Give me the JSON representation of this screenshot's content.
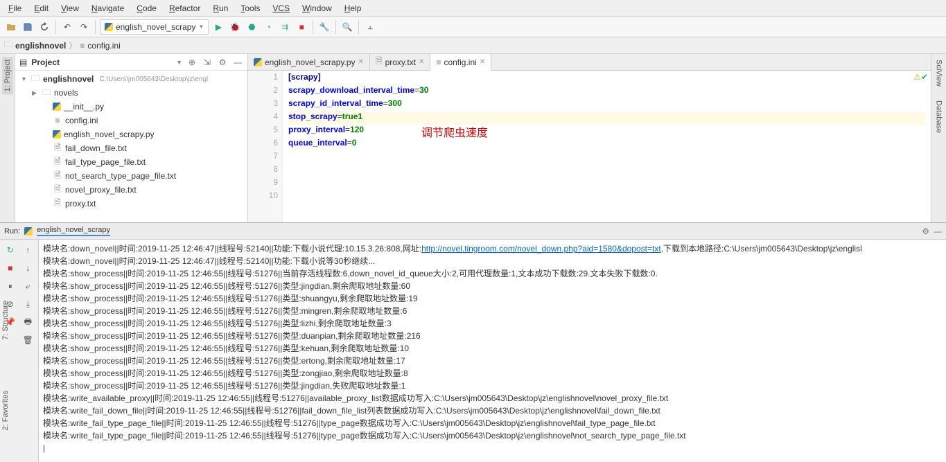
{
  "menu": {
    "file": "File",
    "edit": "Edit",
    "view": "View",
    "navigate": "Navigate",
    "code": "Code",
    "refactor": "Refactor",
    "run": "Run",
    "tools": "Tools",
    "vcs": "VCS",
    "window": "Window",
    "help": "Help"
  },
  "toolbar": {
    "run_config": "english_novel_scrapy"
  },
  "breadcrumb": {
    "root": "englishnovel",
    "file": "config.ini"
  },
  "project": {
    "title": "Project",
    "root": {
      "name": "englishnovel",
      "path": "C:\\Users\\jm005643\\Desktop\\jz\\engl"
    },
    "items": [
      {
        "name": "novels",
        "type": "folder"
      },
      {
        "name": "__init__.py",
        "type": "py"
      },
      {
        "name": "config.ini",
        "type": "ini"
      },
      {
        "name": "english_novel_scrapy.py",
        "type": "py"
      },
      {
        "name": "fail_down_file.txt",
        "type": "txt"
      },
      {
        "name": "fail_type_page_file.txt",
        "type": "txt"
      },
      {
        "name": "not_search_type_page_file.txt",
        "type": "txt"
      },
      {
        "name": "novel_proxy_file.txt",
        "type": "txt"
      },
      {
        "name": "proxy.txt",
        "type": "txt"
      }
    ]
  },
  "tabs": [
    {
      "name": "english_novel_scrapy.py",
      "type": "py",
      "active": false
    },
    {
      "name": "proxy.txt",
      "type": "txt",
      "active": false
    },
    {
      "name": "config.ini",
      "type": "ini",
      "active": true
    }
  ],
  "editor": {
    "lines": [
      "1",
      "2",
      "3",
      "4",
      "5",
      "6",
      "7",
      "8",
      "9",
      "10"
    ],
    "code": [
      {
        "type": "sect",
        "text": "[scrapy]"
      },
      {
        "type": "kv",
        "k": "scrapy_download_interval_time",
        "v": "30"
      },
      {
        "type": "kv",
        "k": "scrapy_id_interval_time",
        "v": "300"
      },
      {
        "type": "kv",
        "k": "stop_scrapy",
        "v": "true1",
        "sel": true
      },
      {
        "type": "kv",
        "k": "proxy_interval",
        "v": "120"
      },
      {
        "type": "kv",
        "k": "queue_interval",
        "v": "0"
      }
    ],
    "annotation": "调节爬虫速度"
  },
  "run": {
    "label": "Run:",
    "name": "english_novel_scrapy",
    "lines": [
      {
        "pre": "模块名:down_novel||时间:2019-11-25 12:46:47||线程号:52140||功能:下载小说代理:10.15.3.26:808,网址:",
        "link": "http://novel.tingroom.com/novel_down.php?aid=1580&dopost=txt",
        "post": ",下载到本地路径:C:\\Users\\jm005643\\Desktop\\jz\\englisl"
      },
      {
        "pre": "模块名:down_novel||时间:2019-11-25 12:46:47||线程号:52140||功能:下载小说等30秒继续..."
      },
      {
        "pre": "模块名:show_process||时间:2019-11-25 12:46:55||线程号:51276||当前存活线程数:6,down_novel_id_queue大小:2,可用代理数量:1,文本成功下载数:29.文本失败下载数:0."
      },
      {
        "pre": "模块名:show_process||时间:2019-11-25 12:46:55||线程号:51276||类型:jingdian,剩余爬取地址数量:60"
      },
      {
        "pre": "模块名:show_process||时间:2019-11-25 12:46:55||线程号:51276||类型:shuangyu,剩余爬取地址数量:19"
      },
      {
        "pre": "模块名:show_process||时间:2019-11-25 12:46:55||线程号:51276||类型:mingren,剩余爬取地址数量:6"
      },
      {
        "pre": "模块名:show_process||时间:2019-11-25 12:46:55||线程号:51276||类型:lizhi,剩余爬取地址数量:3"
      },
      {
        "pre": "模块名:show_process||时间:2019-11-25 12:46:55||线程号:51276||类型:duanpian,剩余爬取地址数量:216"
      },
      {
        "pre": "模块名:show_process||时间:2019-11-25 12:46:55||线程号:51276||类型:kehuan,剩余爬取地址数量:10"
      },
      {
        "pre": "模块名:show_process||时间:2019-11-25 12:46:55||线程号:51276||类型:ertong,剩余爬取地址数量:17"
      },
      {
        "pre": "模块名:show_process||时间:2019-11-25 12:46:55||线程号:51276||类型:zongjiao,剩余爬取地址数量:8"
      },
      {
        "pre": "模块名:show_process||时间:2019-11-25 12:46:55||线程号:51276||类型:jingdian,失败爬取地址数量:1"
      },
      {
        "pre": "模块名:write_available_proxy||时间:2019-11-25 12:46:55||线程号:51276||available_proxy_list数据成功写入:C:\\Users\\jm005643\\Desktop\\jz\\englishnovel\\novel_proxy_file.txt"
      },
      {
        "pre": "模块名:write_fail_down_file||时间:2019-11-25 12:46:55||线程号:51276||fail_down_file_list列表数据成功写入:C:\\Users\\jm005643\\Desktop\\jz\\englishnovel\\fail_down_file.txt"
      },
      {
        "pre": "模块名:write_fail_type_page_file||时间:2019-11-25 12:46:55||线程号:51276||type_page数据成功写入:C:\\Users\\jm005643\\Desktop\\jz\\englishnovel\\fail_type_page_file.txt"
      },
      {
        "pre": "模块名:write_fail_type_page_file||时间:2019-11-25 12:46:55||线程号:51276||type_page数据成功写入:C:\\Users\\jm005643\\Desktop\\jz\\englishnovel\\not_search_type_page_file.txt"
      }
    ]
  },
  "side_tabs": {
    "project": "1: Project",
    "sciview": "SciView",
    "database": "Database",
    "structure": "7: Structure",
    "favorites": "2: Favorites"
  }
}
